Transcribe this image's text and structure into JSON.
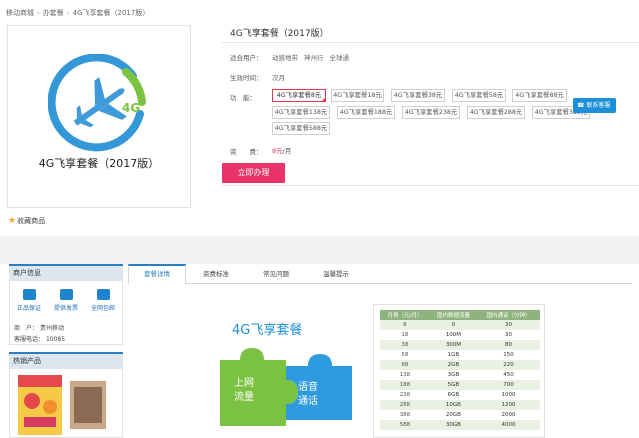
{
  "breadcrumb": [
    "移动商城",
    "办套餐",
    "4G飞享套餐（2017版）"
  ],
  "product": {
    "image_title": "4G飞享套餐（2017版）",
    "logo_text": "4G",
    "title": "4G飞享套餐（2017版）",
    "collect_label": "收藏商品"
  },
  "details": {
    "users_label": "适合用户：",
    "users": [
      "动感地带",
      "神州行",
      "全球通"
    ],
    "effective_label": "生效时间：",
    "effective_value": "次月",
    "function_label": "功　能：",
    "options": [
      "4G飞享套餐8元",
      "4G飞享套餐18元",
      "4G飞享套餐38元",
      "4G飞享套餐58元",
      "4G飞享套餐88元",
      "4G飞享套餐138元",
      "4G飞享套餐188元",
      "4G飞享套餐238元",
      "4G飞享套餐288元",
      "4G飞享套餐388元",
      "4G飞享套餐588元"
    ],
    "fee_label": "资　　费：",
    "fee_value": "8元",
    "fee_unit": "/月",
    "buy_label": "立即办理",
    "service_label": "联系客服"
  },
  "merchant": {
    "title": "商户信息",
    "badges": [
      "正品保证",
      "提供发票",
      "全网包邮"
    ],
    "merchant_label": "商　户：",
    "merchant_value": "贵州移动",
    "phone_label": "客服电话：",
    "phone_value": "10085"
  },
  "hot": {
    "title": "热销产品"
  },
  "tabs": [
    "套餐详情",
    "资费标准",
    "常见问题",
    "温馨提示"
  ],
  "promo": {
    "heading": "4G飞享套餐",
    "piece_left": [
      "上网",
      "流量"
    ],
    "piece_right": [
      "语音",
      "通话"
    ]
  },
  "table": {
    "headers": [
      "月费（元/月）",
      "国内数据流量",
      "国内通话（分钟）"
    ],
    "rows": [
      [
        "8",
        "0",
        "30"
      ],
      [
        "18",
        "100M",
        "30"
      ],
      [
        "38",
        "300M",
        "80"
      ],
      [
        "58",
        "1GB",
        "150"
      ],
      [
        "88",
        "2GB",
        "220"
      ],
      [
        "138",
        "3GB",
        "450"
      ],
      [
        "188",
        "5GB",
        "700"
      ],
      [
        "238",
        "6GB",
        "1000"
      ],
      [
        "288",
        "10GB",
        "1200"
      ],
      [
        "388",
        "20GB",
        "2000"
      ],
      [
        "588",
        "30GB",
        "4000"
      ]
    ]
  },
  "colors": {
    "accent": "#e8336a",
    "brand_blue": "#2a7ec4",
    "table_header": "#8fb37e"
  }
}
